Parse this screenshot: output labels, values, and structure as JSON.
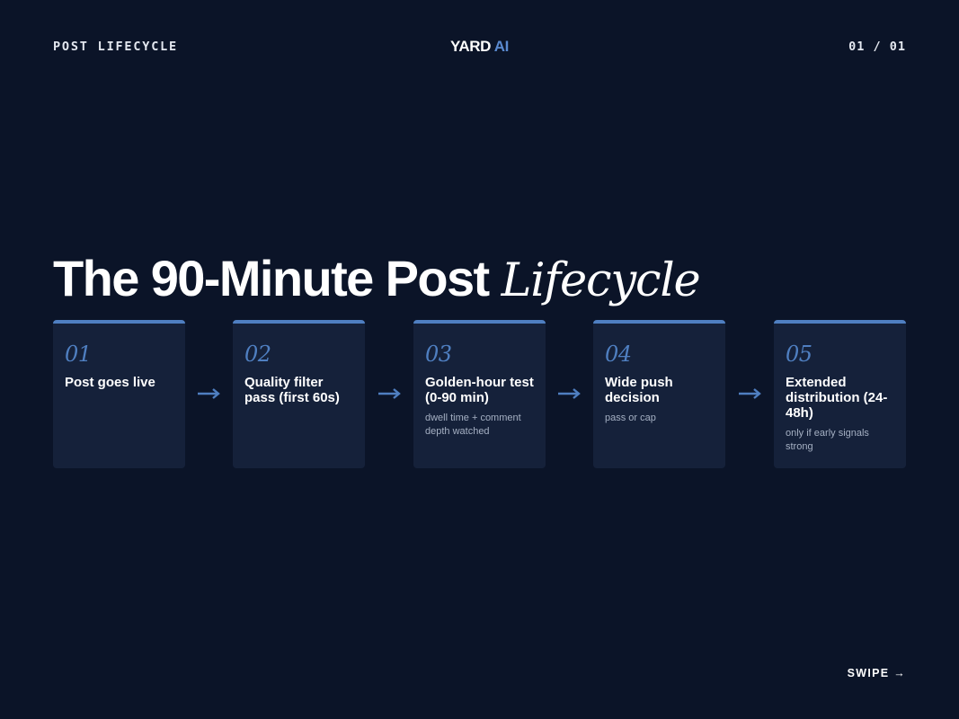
{
  "header": {
    "section_label": "POST LIFECYCLE",
    "brand_main": "YARD",
    "brand_accent": "AI",
    "page_indicator": "01 / 01"
  },
  "title": {
    "main": "The 90-Minute Post",
    "italic": "Lifecycle"
  },
  "steps": [
    {
      "number": "01",
      "title": "Post goes live",
      "detail": ""
    },
    {
      "number": "02",
      "title": "Quality filter pass (first 60s)",
      "detail": ""
    },
    {
      "number": "03",
      "title": "Golden-hour test (0-90 min)",
      "detail": "dwell time + comment depth watched"
    },
    {
      "number": "04",
      "title": "Wide push decision",
      "detail": "pass or cap"
    },
    {
      "number": "05",
      "title": "Extended distribution (24-48h)",
      "detail": "only if early signals strong"
    }
  ],
  "footer": {
    "swipe_label": "SWIPE →"
  },
  "colors": {
    "background": "#0b1428",
    "card": "#15213a",
    "accent": "#4f7fc1"
  }
}
